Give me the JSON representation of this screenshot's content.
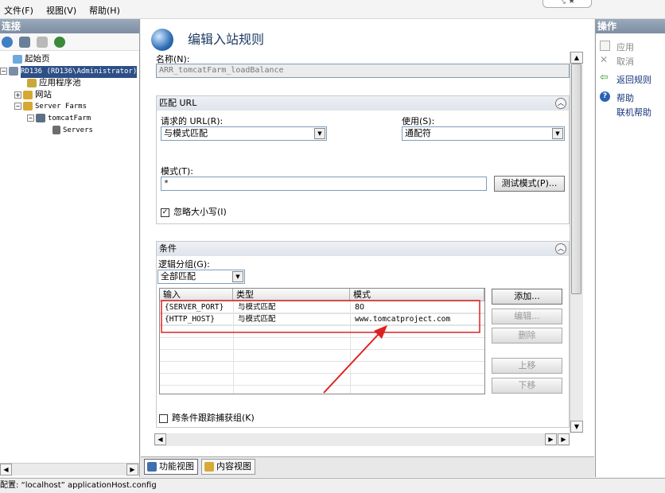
{
  "menubar": {
    "file": "文件(F)",
    "view": "视图(V)",
    "help": "帮助(H)"
  },
  "window_controls": {
    "label": "⤡  ★"
  },
  "left_pane": {
    "title": "连接",
    "tree": [
      {
        "label": "起始页"
      },
      {
        "label": "RD136 (RD136\\Administrator)"
      },
      {
        "label": "应用程序池"
      },
      {
        "label": "网站"
      },
      {
        "label": "Server Farms"
      },
      {
        "label": "tomcatFarm"
      },
      {
        "label": "Servers"
      }
    ]
  },
  "center": {
    "page_title": "编辑入站规则",
    "name_label": "名称(N):",
    "name_value": "ARR_tomcatFarm_loadBalance",
    "match_url": {
      "header": "匹配 URL",
      "requested_url_label": "请求的 URL(R):",
      "requested_url_value": "与模式匹配",
      "using_label": "使用(S):",
      "using_value": "通配符",
      "pattern_label": "模式(T):",
      "pattern_value": "*",
      "test_pattern_button": "测试模式(P)...",
      "ignore_case_label": "忽略大小写(I)",
      "ignore_case_checked": true
    },
    "conditions": {
      "header": "条件",
      "logical_grouping_label": "逻辑分组(G):",
      "logical_grouping_value": "全部匹配",
      "columns": [
        "输入",
        "类型",
        "模式"
      ],
      "rows": [
        {
          "input": "{SERVER_PORT}",
          "type": "与模式匹配",
          "pattern": "80"
        },
        {
          "input": "{HTTP_HOST}",
          "type": "与模式匹配",
          "pattern": "www.tomcatproject.com"
        }
      ],
      "buttons": {
        "add": "添加...",
        "edit": "编辑...",
        "delete": "删除",
        "move_up": "上移",
        "move_down": "下移"
      },
      "track_captures_label": "跨条件跟踪捕获组(K)",
      "track_captures_checked": false
    },
    "tabs": {
      "features": "功能视图",
      "content": "内容视图"
    }
  },
  "right_pane": {
    "title": "操作",
    "apply": "应用",
    "cancel": "取消",
    "back_to_rules": "返回规则",
    "help": "帮助",
    "online_help": "联机帮助"
  },
  "status_bar": {
    "text": "配置: “localhost” applicationHost.config"
  },
  "colors": {
    "annotation_red": "#e02020",
    "selection": "#2d4f86",
    "link": "#15357a"
  }
}
